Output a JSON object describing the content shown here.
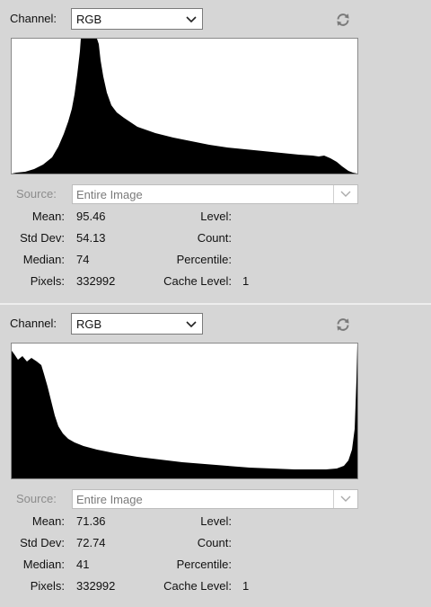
{
  "labels": {
    "channel": "Channel:",
    "source": "Source:",
    "mean": "Mean:",
    "std_dev": "Std Dev:",
    "median": "Median:",
    "pixels": "Pixels:",
    "level": "Level:",
    "count": "Count:",
    "percentile": "Percentile:",
    "cache_level": "Cache Level:"
  },
  "icons": {
    "refresh": "refresh-icon",
    "dropdown": "chevron-down-icon"
  },
  "colors": {
    "panel_bg": "#d6d6d6",
    "histogram_fill": "#000000",
    "disabled_text": "#8c8c8c"
  },
  "panels": [
    {
      "channel": "RGB",
      "source": "Entire Image",
      "mean": "95.46",
      "std_dev": "54.13",
      "median": "74",
      "pixels": "332992",
      "level": "",
      "count": "",
      "percentile": "",
      "cache_level": "1"
    },
    {
      "channel": "RGB",
      "source": "Entire Image",
      "mean": "71.36",
      "std_dev": "72.74",
      "median": "41",
      "pixels": "332992",
      "level": "",
      "count": "",
      "percentile": "",
      "cache_level": "1"
    }
  ]
}
